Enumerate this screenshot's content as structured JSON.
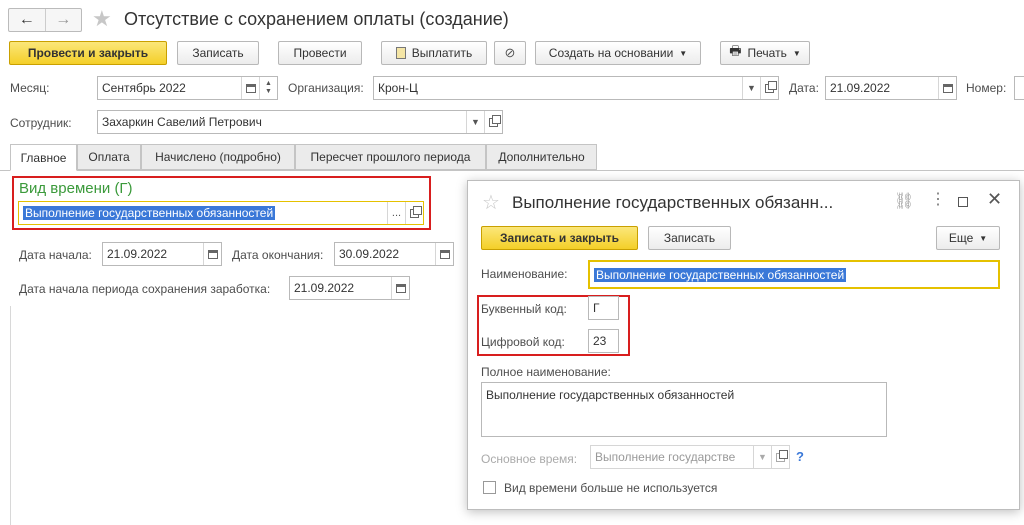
{
  "window": {
    "title": "Отсутствие с сохранением оплаты (создание)"
  },
  "nav": {
    "back": "←",
    "forward": "→",
    "star": "★"
  },
  "toolbar": {
    "post_close": "Провести и закрыть",
    "save": "Записать",
    "post": "Провести",
    "pay": "Выплатить",
    "create_basis": "Создать на основании",
    "print": "Печать"
  },
  "header": {
    "month_label": "Месяц:",
    "month_value": "Сентябрь 2022",
    "org_label": "Организация:",
    "org_value": "Крон-Ц",
    "date_label": "Дата:",
    "date_value": "21.09.2022",
    "number_label": "Номер:",
    "employee_label": "Сотрудник:",
    "employee_value": "Захаркин Савелий Петрович"
  },
  "tabs": [
    "Главное",
    "Оплата",
    "Начислено (подробно)",
    "Пересчет прошлого периода",
    "Дополнительно"
  ],
  "main": {
    "time_type_label": "Вид времени (Г)",
    "time_type_value": "Выполнение государственных обязанностей",
    "start_label": "Дата начала:",
    "start_value": "21.09.2022",
    "end_label": "Дата окончания:",
    "end_value": "30.09.2022",
    "pay_period_label": "Дата начала периода сохранения заработка:",
    "pay_period_value": "21.09.2022"
  },
  "dialog": {
    "title": "Выполнение государственных обязанн...",
    "save_close": "Записать и закрыть",
    "save": "Записать",
    "more": "Еще",
    "name_label": "Наименование:",
    "name_value": "Выполнение государственных обязанностей",
    "letter_code_label": "Буквенный код:",
    "letter_code_value": "Г",
    "digit_code_label": "Цифровой код:",
    "digit_code_value": "23",
    "full_name_label": "Полное наименование:",
    "full_name_value": "Выполнение государственных обязанностей",
    "main_time_label": "Основное время:",
    "main_time_value": "Выполнение государстве",
    "help": "?",
    "unused_label": "Вид времени больше не используется"
  },
  "colors": {
    "accent_yellow": "#f4cf28",
    "highlight_red": "#d81e1e",
    "selection_blue": "#3a78d8",
    "group_green": "#3b9a3b"
  }
}
